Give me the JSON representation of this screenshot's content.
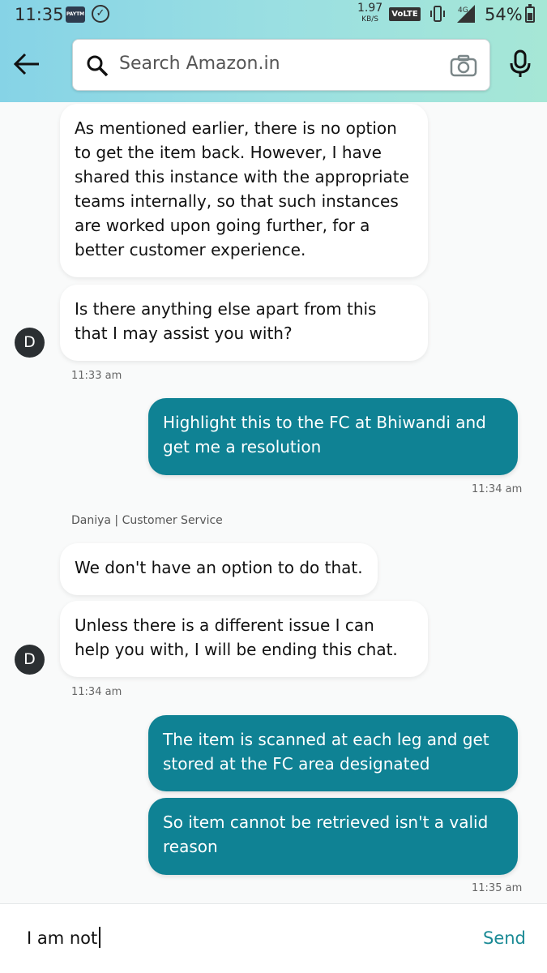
{
  "status_bar": {
    "time": "11:35",
    "paytm": "PAYTM",
    "net_speed": "1.97",
    "net_unit": "KB/S",
    "volte": "VoLTE",
    "network": "4G",
    "battery": "54%"
  },
  "header": {
    "search_placeholder": "Search Amazon.in"
  },
  "messages": {
    "m1": "As mentioned earlier, there is no option to get the item back. However, I have shared this instance with the appropriate teams internally, so that such instances are worked upon going further, for a better customer experience.",
    "m2": "Is there anything else apart from this that I may assist you with?",
    "t1": "11:33 am",
    "m3": "Highlight this to the FC at Bhiwandi and get me a resolution",
    "t2": "11:34 am",
    "agent": "Daniya | Customer Service",
    "m4": "We don't have an option to do that.",
    "m5": "Unless there is a different issue I can help you with, I will be ending this chat.",
    "t3": "11:34 am",
    "m6": "The item is scanned at each leg and get stored at the FC area designated",
    "m7": "So item cannot be retrieved isn't a valid reason",
    "t4": "11:35 am",
    "avatar_letter": "D"
  },
  "composer": {
    "text": "I am not",
    "send_label": "Send"
  },
  "colors": {
    "outgoing_bubble": "#0f8294",
    "send": "#1a8a95"
  }
}
